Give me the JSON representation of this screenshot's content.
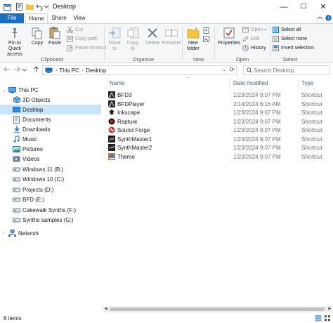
{
  "window": {
    "title": "Desktop",
    "controls": {
      "minimize": "—",
      "maximize": "☐",
      "close": "✕"
    }
  },
  "ribbon_tabs": [
    "File",
    "Home",
    "Share",
    "View"
  ],
  "ribbon": {
    "clipboard": {
      "pin_to_quick_access": "Pin to Quick\naccess",
      "copy": "Copy",
      "paste": "Paste",
      "cut": "Cut",
      "copy_path": "Copy path",
      "paste_shortcut": "Paste shortcut",
      "label": "Clipboard"
    },
    "organize": {
      "move_to": "Move\nto",
      "copy_to": "Copy\nto",
      "delete": "Delete",
      "rename": "Rename",
      "label": "Organize"
    },
    "new": {
      "new_folder": "New\nfolder",
      "label": "New"
    },
    "open": {
      "properties": "Properties",
      "open": "Open",
      "edit": "Edit",
      "history": "History",
      "label": "Open"
    },
    "select": {
      "select_all": "Select all",
      "select_none": "Select none",
      "invert_selection": "Invert selection",
      "label": "Select"
    }
  },
  "address": {
    "crumbs": [
      "This PC",
      "Desktop"
    ],
    "search_placeholder": "Search Desktop"
  },
  "nav_pane": [
    {
      "label": "This PC",
      "icon": "computer-icon"
    },
    {
      "label": "3D Objects",
      "icon": "cube-icon"
    },
    {
      "label": "Desktop",
      "icon": "desktop-icon",
      "selected": true
    },
    {
      "label": "Documents",
      "icon": "documents-icon"
    },
    {
      "label": "Downloads",
      "icon": "downloads-icon"
    },
    {
      "label": "Music",
      "icon": "music-icon"
    },
    {
      "label": "Pictures",
      "icon": "pictures-icon"
    },
    {
      "label": "Videos",
      "icon": "videos-icon"
    },
    {
      "label": "Windows 11 (B:)",
      "icon": "drive-icon"
    },
    {
      "label": "Windows 10 (C:)",
      "icon": "drive-icon"
    },
    {
      "label": "Projects (D:)",
      "icon": "drive-icon"
    },
    {
      "label": "BFD (E:)",
      "icon": "drive-icon"
    },
    {
      "label": "Cakewalk Synths (F:)",
      "icon": "drive-icon"
    },
    {
      "label": "Synths samples (G:)",
      "icon": "drive-icon"
    },
    {
      "label": "Network",
      "icon": "network-icon"
    }
  ],
  "columns": {
    "name": "Name",
    "date_modified": "Date modified",
    "type": "Type"
  },
  "files": [
    {
      "name": "BFD3",
      "date": "1/23/2024 9:07 PM",
      "type": "Shortcut",
      "icon": "bfd-icon",
      "color": "#2b2b2b"
    },
    {
      "name": "BFDPlayer",
      "date": "2/14/2024 6:16 AM",
      "type": "Shortcut",
      "icon": "bfd-icon",
      "color": "#2b2b2b"
    },
    {
      "name": "Inkscape",
      "date": "1/23/2024 9:07 PM",
      "type": "Shortcut",
      "icon": "inkscape-icon",
      "color": "#222222"
    },
    {
      "name": "Rapture",
      "date": "1/23/2024 9:07 PM",
      "type": "Shortcut",
      "icon": "rapture-icon",
      "color": "#b22222"
    },
    {
      "name": "Sound Forge",
      "date": "1/23/2024 9:07 PM",
      "type": "Shortcut",
      "icon": "soundforge-icon",
      "color": "#c0392b"
    },
    {
      "name": "SynthMaster1",
      "date": "1/23/2024 9:07 PM",
      "type": "Shortcut",
      "icon": "synthmaster-icon",
      "color": "#1f1f1f"
    },
    {
      "name": "SynthMaster2",
      "date": "1/23/2024 9:07 PM",
      "type": "Shortcut",
      "icon": "synthmaster-icon",
      "color": "#1f1f1f"
    },
    {
      "name": "Theme",
      "date": "1/23/2024 9:07 PM",
      "type": "Shortcut",
      "icon": "theme-icon",
      "color": "#e8742a"
    }
  ],
  "status": {
    "item_count": "8 items"
  },
  "colors": {
    "accent": "#1a6fc4",
    "selection": "#cce4f7",
    "folder": "#f4c542"
  }
}
